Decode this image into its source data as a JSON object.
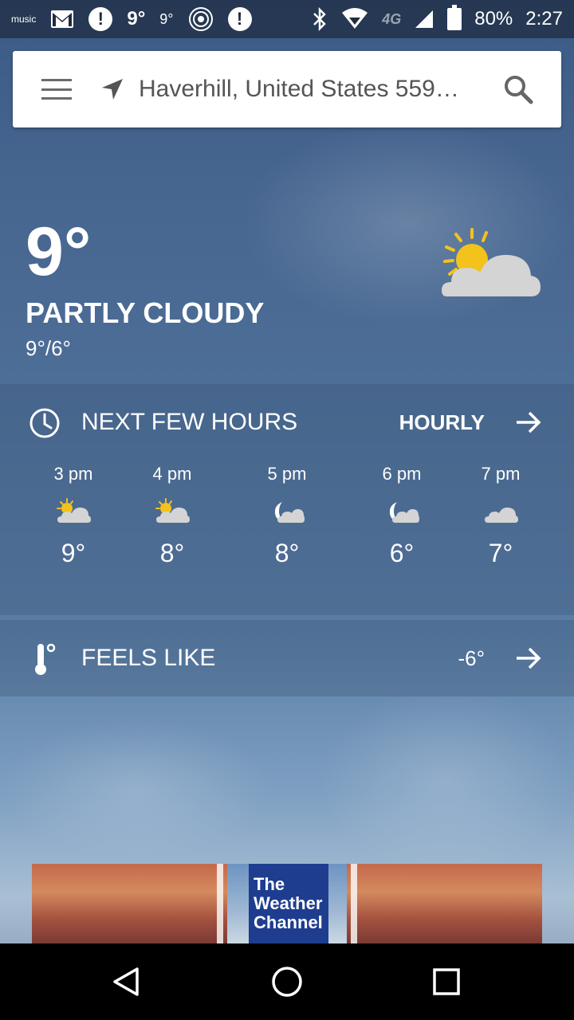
{
  "status_bar": {
    "music_label": "music",
    "temp_large": "9°",
    "temp_small": "9°",
    "network": "4G",
    "battery": "80%",
    "time": "2:27"
  },
  "search_bar": {
    "location": "Haverhill, United States 559…"
  },
  "current": {
    "temperature": "9°",
    "condition": "PARTLY CLOUDY",
    "high_low": "9°/6°",
    "icon": "partly-cloudy-day-icon"
  },
  "next_hours": {
    "title": "NEXT FEW HOURS",
    "link_label": "HOURLY",
    "hours": [
      {
        "time": "3 pm",
        "icon": "partly-cloudy-day-icon",
        "temp": "9°"
      },
      {
        "time": "4 pm",
        "icon": "partly-cloudy-day-icon",
        "temp": "8°"
      },
      {
        "time": "5 pm",
        "icon": "partly-cloudy-night-icon",
        "temp": "8°"
      },
      {
        "time": "6 pm",
        "icon": "partly-cloudy-night-icon",
        "temp": "6°"
      },
      {
        "time": "7 pm",
        "icon": "cloudy-icon",
        "temp": "7°"
      }
    ]
  },
  "feels_like": {
    "title": "FEELS LIKE",
    "value": "-6°"
  },
  "ad": {
    "logo_line1": "The",
    "logo_line2": "Weather",
    "logo_line3": "Channel"
  },
  "colors": {
    "sun": "#f3c21b",
    "cloud": "#d4d4d4",
    "logo_blue": "#1f3d8f"
  }
}
